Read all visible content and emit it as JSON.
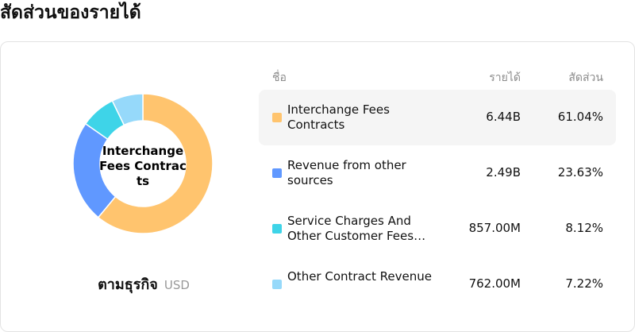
{
  "page": {
    "title": "สัดส่วนของรายได้"
  },
  "donut": {
    "center_label": "Interchange Fees Contracts"
  },
  "breakdown": {
    "label": "ตามธุรกิจ",
    "currency": "USD"
  },
  "table": {
    "headers": {
      "name": "ชื่อ",
      "revenue": "รายได้",
      "share": "สัดส่วน"
    }
  },
  "colors": {
    "interchange": "#FFC46E",
    "revenue_other": "#6098FF",
    "service": "#3ED4E8",
    "other_contract": "#96D9FA"
  },
  "chart_data": {
    "type": "pie",
    "categories": [
      "Interchange Fees Contracts",
      "Revenue from other sources",
      "Service Charges And Other Customer Fees…",
      "Other Contract Revenue"
    ],
    "values": [
      61.04,
      23.63,
      8.12,
      7.22
    ],
    "revenue_labels": [
      "6.44B",
      "2.49B",
      "857.00M",
      "762.00M"
    ],
    "share_labels": [
      "61.04%",
      "23.63%",
      "8.12%",
      "7.22%"
    ],
    "colors": [
      "#FFC46E",
      "#6098FF",
      "#3ED4E8",
      "#96D9FA"
    ],
    "highlighted_index": 0
  }
}
